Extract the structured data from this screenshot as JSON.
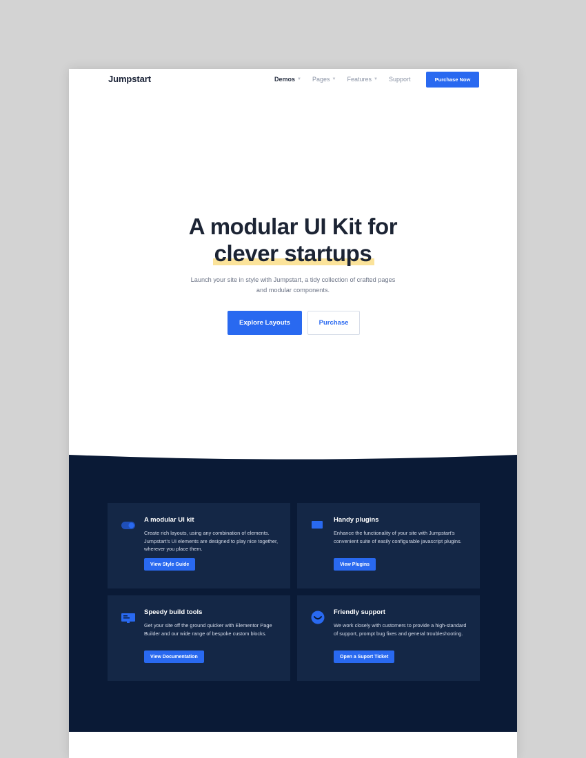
{
  "header": {
    "logo": "Jumpstart",
    "nav": [
      {
        "label": "Demos",
        "has_dropdown": true,
        "active": true
      },
      {
        "label": "Pages",
        "has_dropdown": true,
        "active": false
      },
      {
        "label": "Features",
        "has_dropdown": true,
        "active": false
      },
      {
        "label": "Support",
        "has_dropdown": false,
        "active": false
      }
    ],
    "cta_label": "Purchase Now"
  },
  "hero": {
    "title_line1": "A modular UI Kit for",
    "title_line2": "clever startups",
    "subtitle": "Launch your site in style with Jumpstart, a tidy collection of crafted pages and modular components.",
    "primary_button": "Explore Layouts",
    "secondary_button": "Purchase"
  },
  "features": [
    {
      "icon": "toggle-icon",
      "title": "A modular UI kit",
      "description": "Create rich layouts, using any combination of elements. Jumpstart's UI elements are designed to play nice together, wherever you place them.",
      "button": "View Style Guide"
    },
    {
      "icon": "plugin-icon",
      "title": "Handy plugins",
      "description": "Enhance the functionality of your site with Jumpstart's convenient suite of easily configurable javascript plugins.",
      "button": "View Plugins"
    },
    {
      "icon": "monitor-icon",
      "title": "Speedy build tools",
      "description": "Get your site off the ground quicker with Elementor Page Builder and our wide range of bespoke custom blocks.",
      "button": "View Documentation"
    },
    {
      "icon": "smile-icon",
      "title": "Friendly support",
      "description": "We work closely with customers to provide a high-standard of support, prompt bug fixes and general troubleshooting.",
      "button": "Open a Suport Ticket"
    }
  ],
  "colors": {
    "accent": "#2969f0",
    "dark_bg": "#0a1a36",
    "card_bg": "#142746",
    "highlight": "#fbe39a"
  }
}
